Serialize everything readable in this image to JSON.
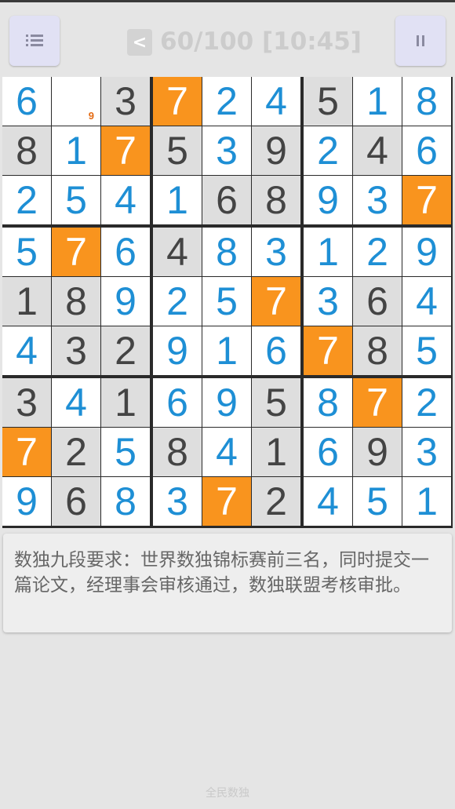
{
  "header": {
    "back_label": "<",
    "progress": "60/100",
    "timer": "[10:45]",
    "status_text": "60/100 [10:45]"
  },
  "board": {
    "highlight_digit": 7,
    "rows": [
      [
        {
          "v": "6",
          "t": "user"
        },
        {
          "v": "",
          "t": "empty",
          "note": "9"
        },
        {
          "v": "3",
          "t": "given"
        },
        {
          "v": "7",
          "t": "hl"
        },
        {
          "v": "2",
          "t": "user"
        },
        {
          "v": "4",
          "t": "user"
        },
        {
          "v": "5",
          "t": "given"
        },
        {
          "v": "1",
          "t": "user"
        },
        {
          "v": "8",
          "t": "user"
        }
      ],
      [
        {
          "v": "8",
          "t": "given"
        },
        {
          "v": "1",
          "t": "user"
        },
        {
          "v": "7",
          "t": "hl"
        },
        {
          "v": "5",
          "t": "given"
        },
        {
          "v": "3",
          "t": "user"
        },
        {
          "v": "9",
          "t": "given"
        },
        {
          "v": "2",
          "t": "user"
        },
        {
          "v": "4",
          "t": "given"
        },
        {
          "v": "6",
          "t": "user"
        }
      ],
      [
        {
          "v": "2",
          "t": "user"
        },
        {
          "v": "5",
          "t": "user"
        },
        {
          "v": "4",
          "t": "user"
        },
        {
          "v": "1",
          "t": "user"
        },
        {
          "v": "6",
          "t": "given"
        },
        {
          "v": "8",
          "t": "given"
        },
        {
          "v": "9",
          "t": "user"
        },
        {
          "v": "3",
          "t": "user"
        },
        {
          "v": "7",
          "t": "hl"
        }
      ],
      [
        {
          "v": "5",
          "t": "user"
        },
        {
          "v": "7",
          "t": "hl"
        },
        {
          "v": "6",
          "t": "user"
        },
        {
          "v": "4",
          "t": "given"
        },
        {
          "v": "8",
          "t": "user"
        },
        {
          "v": "3",
          "t": "user"
        },
        {
          "v": "1",
          "t": "user"
        },
        {
          "v": "2",
          "t": "user"
        },
        {
          "v": "9",
          "t": "user"
        }
      ],
      [
        {
          "v": "1",
          "t": "given"
        },
        {
          "v": "8",
          "t": "given"
        },
        {
          "v": "9",
          "t": "user"
        },
        {
          "v": "2",
          "t": "user"
        },
        {
          "v": "5",
          "t": "user"
        },
        {
          "v": "7",
          "t": "hl"
        },
        {
          "v": "3",
          "t": "user"
        },
        {
          "v": "6",
          "t": "given"
        },
        {
          "v": "4",
          "t": "user"
        }
      ],
      [
        {
          "v": "4",
          "t": "user"
        },
        {
          "v": "3",
          "t": "given"
        },
        {
          "v": "2",
          "t": "given"
        },
        {
          "v": "9",
          "t": "user"
        },
        {
          "v": "1",
          "t": "user"
        },
        {
          "v": "6",
          "t": "user"
        },
        {
          "v": "7",
          "t": "hl"
        },
        {
          "v": "8",
          "t": "given"
        },
        {
          "v": "5",
          "t": "user"
        }
      ],
      [
        {
          "v": "3",
          "t": "given"
        },
        {
          "v": "4",
          "t": "user"
        },
        {
          "v": "1",
          "t": "given"
        },
        {
          "v": "6",
          "t": "user"
        },
        {
          "v": "9",
          "t": "user"
        },
        {
          "v": "5",
          "t": "given"
        },
        {
          "v": "8",
          "t": "user"
        },
        {
          "v": "7",
          "t": "hl"
        },
        {
          "v": "2",
          "t": "user"
        }
      ],
      [
        {
          "v": "7",
          "t": "hl"
        },
        {
          "v": "2",
          "t": "given"
        },
        {
          "v": "5",
          "t": "user"
        },
        {
          "v": "8",
          "t": "given"
        },
        {
          "v": "4",
          "t": "user"
        },
        {
          "v": "1",
          "t": "given"
        },
        {
          "v": "6",
          "t": "user"
        },
        {
          "v": "9",
          "t": "given"
        },
        {
          "v": "3",
          "t": "user"
        }
      ],
      [
        {
          "v": "9",
          "t": "user"
        },
        {
          "v": "6",
          "t": "given"
        },
        {
          "v": "8",
          "t": "user"
        },
        {
          "v": "3",
          "t": "user"
        },
        {
          "v": "7",
          "t": "hl"
        },
        {
          "v": "2",
          "t": "given"
        },
        {
          "v": "4",
          "t": "user"
        },
        {
          "v": "5",
          "t": "user"
        },
        {
          "v": "1",
          "t": "user"
        }
      ]
    ]
  },
  "info": {
    "text": "数独九段要求：世界数独锦标赛前三名，同时提交一篇论文，经理事会审核通过，数独联盟考核审批。"
  },
  "footer": {
    "app_name": "全民数独"
  },
  "colors": {
    "highlight": "#f9941e",
    "user_digit": "#1e8fd5",
    "given_digit": "#444444",
    "note_digit": "#e46a12"
  },
  "icons": {
    "menu": "menu-icon",
    "pause": "pause-icon"
  }
}
